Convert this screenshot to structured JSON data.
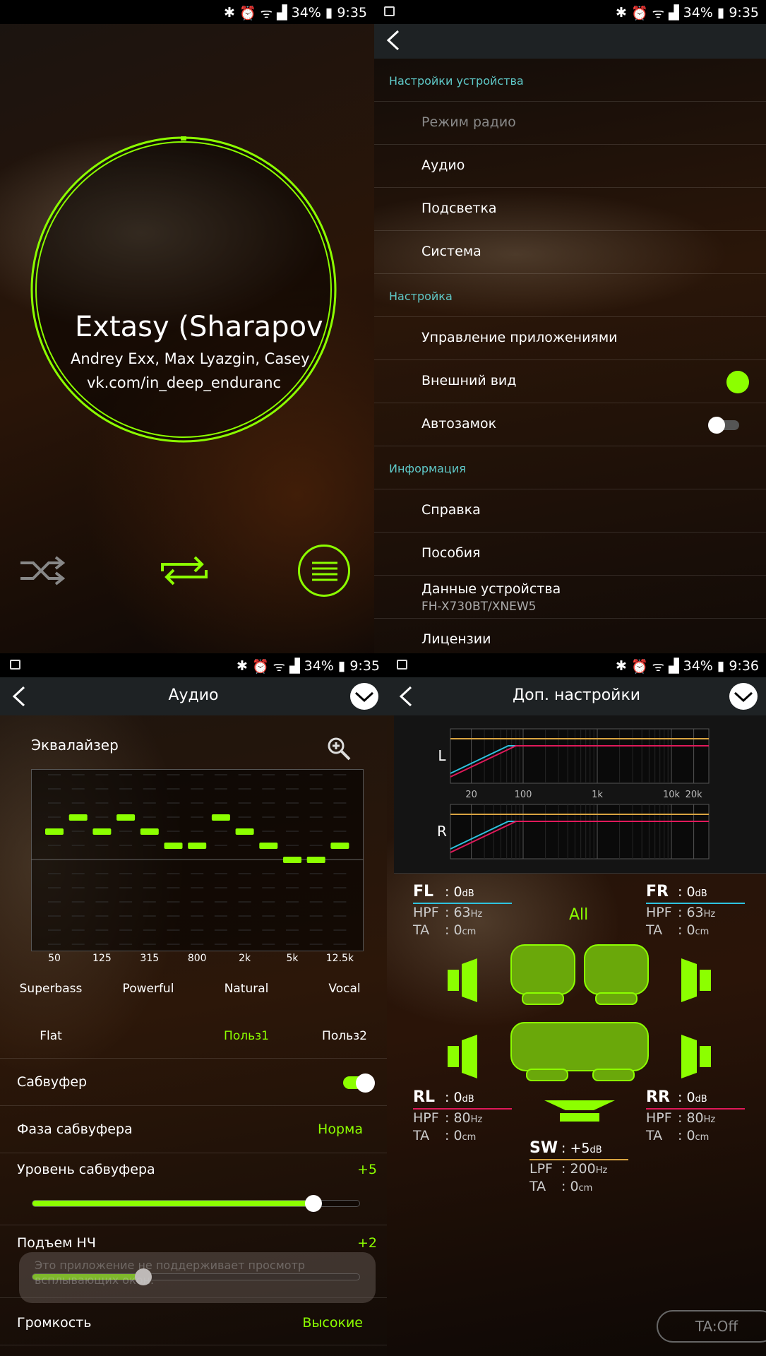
{
  "status_bars": [
    {
      "battery": "34%",
      "time": "9:35"
    },
    {
      "battery": "34%",
      "time": "9:35"
    },
    {
      "battery": "34%",
      "time": "9:35"
    },
    {
      "battery": "34%",
      "time": "9:36"
    }
  ],
  "player": {
    "title": "Extasy (Sharapov R",
    "artist": "Andrey Exx, Max Lyazgin, Casey",
    "album": "vk.com/in_deep_enduranc",
    "accent": "#8cff00",
    "controls": [
      "shuffle-icon",
      "repeat-icon",
      "menu-icon"
    ]
  },
  "settings": {
    "rows": [
      {
        "type": "section",
        "label": "Настройки устройства"
      },
      {
        "type": "item",
        "label": "Режим радио",
        "disabled": true
      },
      {
        "type": "item",
        "label": "Аудио"
      },
      {
        "type": "item",
        "label": "Подсветка"
      },
      {
        "type": "item",
        "label": "Система"
      },
      {
        "type": "section",
        "label": "Настройка"
      },
      {
        "type": "item",
        "label": "Управление приложениями"
      },
      {
        "type": "item",
        "label": "Внешний вид",
        "indicator": "color-dot"
      },
      {
        "type": "item",
        "label": "Автозамок",
        "toggle": false
      },
      {
        "type": "section",
        "label": "Информация"
      },
      {
        "type": "item",
        "label": "Справка"
      },
      {
        "type": "item",
        "label": "Пособия"
      },
      {
        "type": "item",
        "label": "Данные устройства",
        "sub": "FH-X730BT/XNEW5"
      },
      {
        "type": "item",
        "label": "Лицензии"
      }
    ]
  },
  "audio": {
    "title": "Аудио",
    "eq_label": "Эквалайзер",
    "eq": {
      "range": [
        -6,
        6
      ],
      "levels": [
        2,
        3,
        2,
        3,
        2,
        1,
        1,
        3,
        2,
        1,
        0,
        0,
        1
      ],
      "band_labels": [
        "50",
        "125",
        "315",
        "800",
        "2k",
        "5k",
        "12.5k"
      ]
    },
    "presets": [
      {
        "label": "Superbass"
      },
      {
        "label": "Powerful"
      },
      {
        "label": "Natural"
      },
      {
        "label": "Vocal"
      },
      {
        "label": "Flat"
      },
      {
        "label": "Польз1",
        "selected": true
      },
      {
        "label": "Польз2"
      }
    ],
    "subwoofer": {
      "label": "Сабвуфер",
      "on": true
    },
    "phase": {
      "label": "Фаза сабвуфера",
      "value": "Норма"
    },
    "sub_level": {
      "label": "Уровень сабвуфера",
      "value": "+5",
      "fraction": 0.86
    },
    "bass_boost": {
      "label": "Подъем НЧ",
      "value": "+2",
      "fraction": 0.34
    },
    "loudness": {
      "label": "Громкость",
      "value": "Высокие"
    },
    "toast": "Это приложение не поддерживает просмотр всплывающих окон."
  },
  "advanced": {
    "title": "Доп. настройки",
    "graph": {
      "channels": [
        "L",
        "R"
      ],
      "freq_labels": [
        "20",
        "100",
        "1k",
        "10k",
        "20k"
      ]
    },
    "all_label": "All",
    "channels": {
      "FL": {
        "name": "FL",
        "level": ": 0",
        "level_unit": "dB",
        "filter": "HPF",
        "filter_val": ": 63",
        "filter_unit": "Hz",
        "ta": "TA",
        "ta_val": ": 0",
        "ta_unit": "cm",
        "color": "#2ec4e0"
      },
      "FR": {
        "name": "FR",
        "level": ": 0",
        "level_unit": "dB",
        "filter": "HPF",
        "filter_val": ": 63",
        "filter_unit": "Hz",
        "ta": "TA",
        "ta_val": ": 0",
        "ta_unit": "cm",
        "color": "#2ec4e0"
      },
      "RL": {
        "name": "RL",
        "level": ": 0",
        "level_unit": "dB",
        "filter": "HPF",
        "filter_val": ": 80",
        "filter_unit": "Hz",
        "ta": "TA",
        "ta_val": ": 0",
        "ta_unit": "cm",
        "color": "#e0195a"
      },
      "RR": {
        "name": "RR",
        "level": ": 0",
        "level_unit": "dB",
        "filter": "HPF",
        "filter_val": ": 80",
        "filter_unit": "Hz",
        "ta": "TA",
        "ta_val": ": 0",
        "ta_unit": "cm",
        "color": "#e0195a"
      },
      "SW": {
        "name": "SW",
        "level": ": +5",
        "level_unit": "dB",
        "filter": "LPF",
        "filter_val": ": 200",
        "filter_unit": "Hz",
        "ta": "TA",
        "ta_val": ": 0",
        "ta_unit": "cm",
        "color": "#d9a441"
      }
    },
    "ta_button": "TA:Off"
  }
}
